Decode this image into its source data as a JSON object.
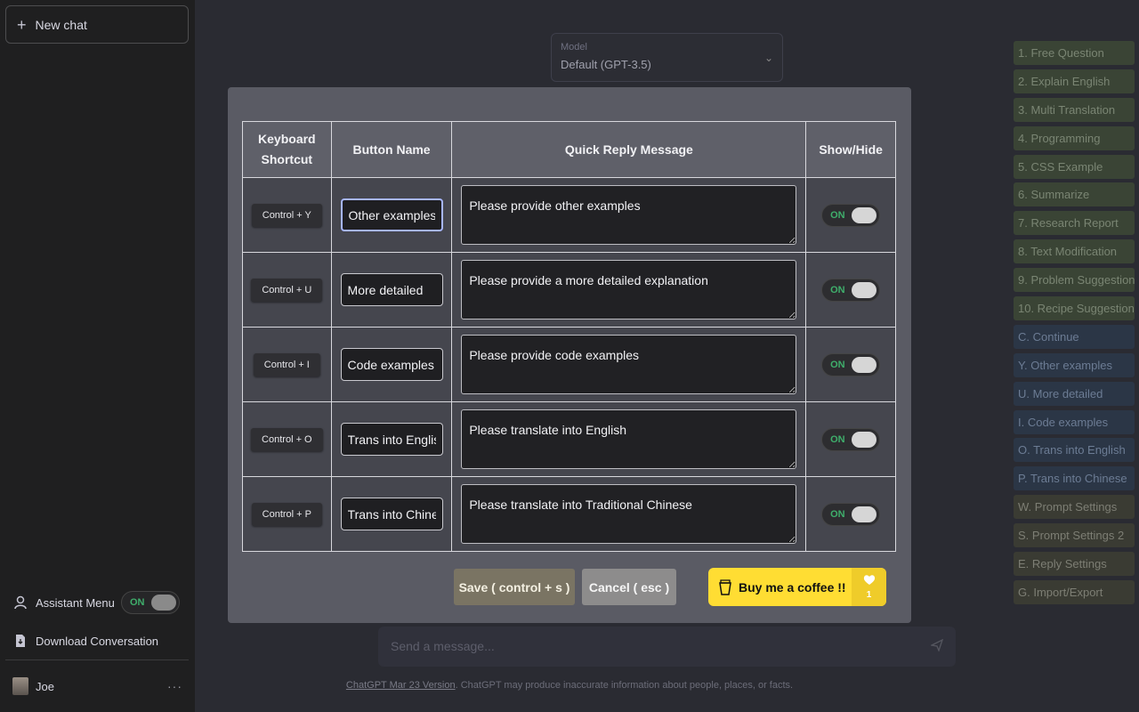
{
  "sidebar": {
    "new_chat": "New chat",
    "assistant_menu": "Assistant Menu",
    "assistant_toggle": "ON",
    "download": "Download Conversation",
    "user": "Joe",
    "more": "···"
  },
  "model": {
    "label": "Model",
    "value": "Default (GPT-3.5)"
  },
  "right_panel": [
    "1. Free Question",
    "2. Explain English",
    "3. Multi Translation",
    "4. Programming",
    "5. CSS Example",
    "6. Summarize",
    "7. Research Report",
    "8. Text Modification",
    "9. Problem Suggestion",
    "10. Recipe Suggestion",
    "C. Continue",
    "Y. Other examples",
    "U. More detailed",
    "I. Code examples",
    "O. Trans into English",
    "P. Trans into Chinese",
    "W. Prompt Settings",
    "S. Prompt Settings 2",
    "E. Reply Settings",
    "G. Import/Export"
  ],
  "composer": {
    "placeholder": "Send a message..."
  },
  "footer": {
    "link": "ChatGPT Mar 23 Version",
    "text": ". ChatGPT may produce inaccurate information about people, places, or facts."
  },
  "modal": {
    "headers": {
      "shortcut_line1": "Keyboard",
      "shortcut_line2": "Shortcut",
      "button_name": "Button Name",
      "message": "Quick Reply Message",
      "show": "Show/Hide"
    },
    "rows": [
      {
        "shortcut": "Control + Y",
        "name": "Other examples",
        "message": "Please provide other examples",
        "toggle": "ON"
      },
      {
        "shortcut": "Control + U",
        "name": "More detailed",
        "message": "Please provide a more detailed explanation",
        "toggle": "ON"
      },
      {
        "shortcut": "Control + I",
        "name": "Code examples",
        "message": "Please provide code examples",
        "toggle": "ON"
      },
      {
        "shortcut": "Control + O",
        "name": "Trans into English",
        "message": "Please translate into English",
        "toggle": "ON"
      },
      {
        "shortcut": "Control + P",
        "name": "Trans into Chinese",
        "message": "Please translate into Traditional Chinese",
        "toggle": "ON"
      }
    ],
    "save": "Save ( control + s )",
    "cancel": "Cancel ( esc )",
    "coffee": "Buy me a coffee !!",
    "coffee_count": "1"
  },
  "colors": {
    "toggle_on": "#3fae6b",
    "coffee": "#ffdd33"
  }
}
